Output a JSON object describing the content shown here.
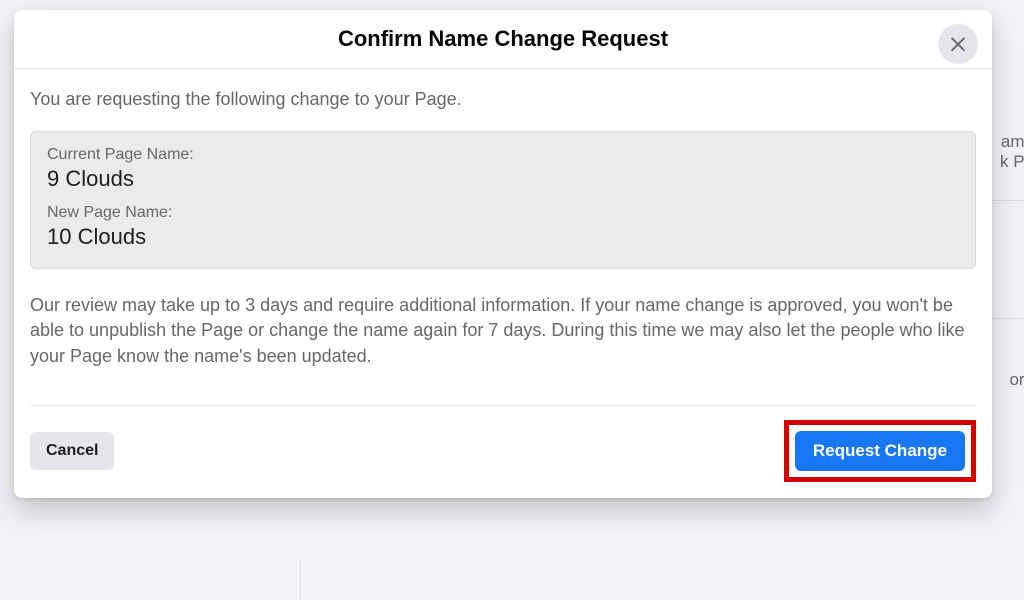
{
  "modal": {
    "title": "Confirm Name Change Request",
    "intro": "You are requesting the following change to your Page.",
    "current_label": "Current Page Name:",
    "current_value": "9 Clouds",
    "new_label": "New Page Name:",
    "new_value": "10 Clouds",
    "info": "Our review may take up to 3 days and require additional information. If your name change is approved, you won't be able to unpublish the Page or change the name again for 7 days. During this time we may also let the people who like your Page know the name's been updated.",
    "cancel_label": "Cancel",
    "request_label": "Request Change"
  },
  "background": {
    "frag1": "ame",
    "frag2": "k Pa",
    "frag3": "or t"
  }
}
